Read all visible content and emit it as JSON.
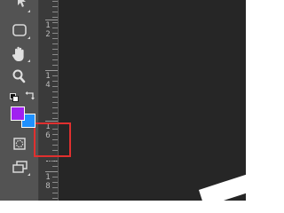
{
  "toolbar": {
    "tools": [
      {
        "name": "move-tool",
        "icon": "arrow-icon"
      },
      {
        "name": "rectangle-tool",
        "icon": "rounded-rect-icon"
      },
      {
        "name": "hand-tool",
        "icon": "hand-icon"
      },
      {
        "name": "zoom-tool",
        "icon": "magnifier-icon"
      },
      {
        "name": "default-colors",
        "icon": "default-colors-icon"
      },
      {
        "name": "swap-colors",
        "icon": "swap-arrow-icon"
      },
      {
        "name": "quick-mask",
        "icon": "dashed-circle-icon"
      },
      {
        "name": "screen-mode",
        "icon": "screen-mode-icon"
      }
    ],
    "foreground_color": "#a020f0",
    "background_color": "#1e90ff"
  },
  "ruler": {
    "labels": [
      {
        "top": "1",
        "bottom": "2"
      },
      {
        "top": "1",
        "bottom": "4"
      },
      {
        "top": "1",
        "bottom": "6"
      },
      {
        "top": "1",
        "bottom": "8"
      }
    ]
  },
  "canvas": {
    "background": "#262626"
  },
  "highlight": {
    "color": "#e0302f"
  }
}
